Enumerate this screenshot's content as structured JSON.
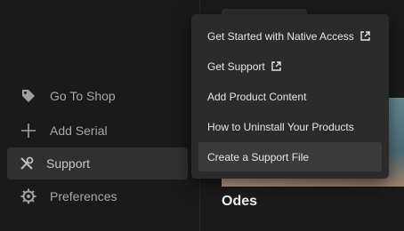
{
  "sidebar": {
    "items": [
      {
        "label": "Go To Shop",
        "icon": "tag-icon"
      },
      {
        "label": "Add Serial",
        "icon": "plus-icon"
      },
      {
        "label": "Support",
        "icon": "tools-icon",
        "active": true
      },
      {
        "label": "Preferences",
        "icon": "gear-icon"
      }
    ]
  },
  "product": {
    "title": "Odes"
  },
  "support_menu": {
    "items": [
      {
        "label": "Get Started with Native Access",
        "external": true
      },
      {
        "label": "Get Support",
        "external": true
      },
      {
        "label": "Add Product Content",
        "external": false
      },
      {
        "label": "How to Uninstall Your Products",
        "external": false
      },
      {
        "label": "Create a Support File",
        "external": false,
        "hovered": true
      }
    ]
  },
  "colors": {
    "menu_bg": "#2b2b2b",
    "active_bg": "#303030",
    "hover_bg": "#3a3a3a"
  }
}
